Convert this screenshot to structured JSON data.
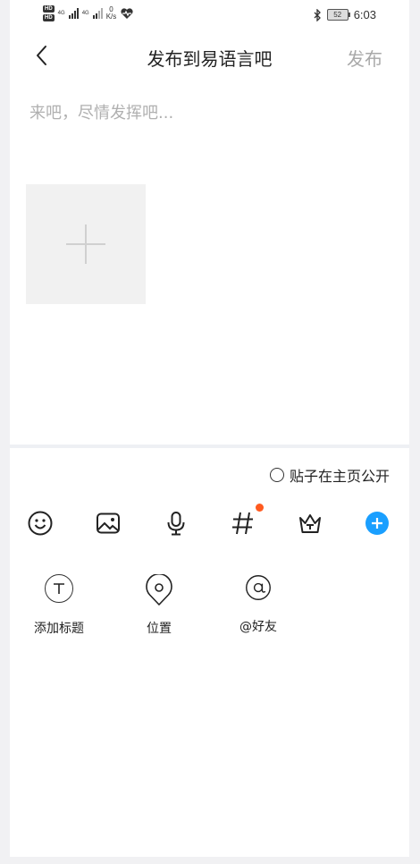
{
  "status_bar": {
    "hd_badge": "HD",
    "network": [
      "4G",
      "4G"
    ],
    "speed_value": "0",
    "speed_unit": "K/s",
    "battery": "52",
    "time": "6:03"
  },
  "header": {
    "title": "发布到易语言吧",
    "publish_label": "发布"
  },
  "compose": {
    "placeholder": "来吧，尽情发挥吧..."
  },
  "options": {
    "public_label": "贴子在主页公开"
  },
  "toolbar": {
    "tools": [
      "emoji-icon",
      "image-icon",
      "microphone-icon",
      "hashtag-icon",
      "crown-icon",
      "plus-icon"
    ],
    "accent": "#1a9fff",
    "badge_color": "#ff5a1f"
  },
  "actions": [
    {
      "icon": "title-icon",
      "label": "添加标题"
    },
    {
      "icon": "location-icon",
      "label": "位置"
    },
    {
      "icon": "at-icon",
      "label": "@好友"
    }
  ]
}
